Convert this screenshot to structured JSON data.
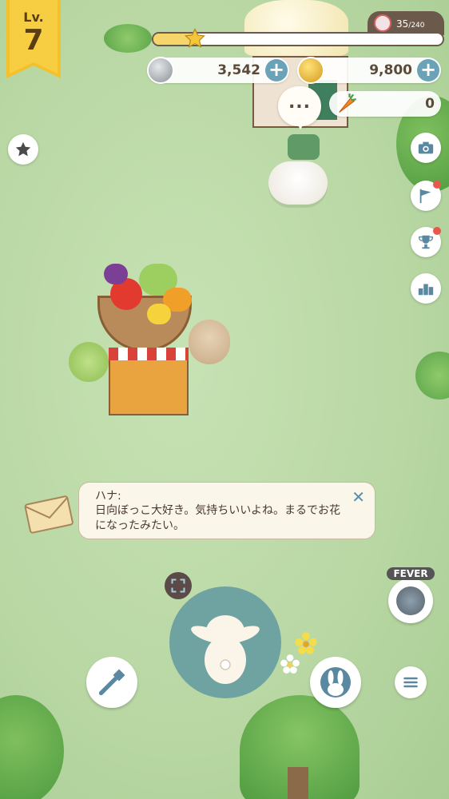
{
  "level": {
    "prefix": "Lv.",
    "value": "7"
  },
  "experience": {
    "current": 35,
    "max": 240,
    "current_label": "35",
    "max_label": "/240"
  },
  "currencies": {
    "silver_coins": "3,542",
    "gold_coins": "9,800",
    "carrots": "0",
    "plus_label": "+"
  },
  "speech_bubble": {
    "text": "..."
  },
  "side_buttons": {
    "camera_icon": "camera-icon",
    "flag_icon": "flag-icon",
    "trophy_icon": "trophy-icon",
    "ranking_icon": "ranking-icon",
    "star_icon": "star-icon"
  },
  "dialog": {
    "speaker": "ハナ:",
    "message": "日向ぼっこ大好き。気持ちいいよね。まるでお花になったみたい。",
    "close_label": "✕"
  },
  "fever": {
    "label": "FEVER"
  },
  "bottom_bar": {
    "expand_icon": "expand-icon",
    "hammer_icon": "hammer-icon",
    "rabbit_icon": "rabbit-icon",
    "menu_icon": "menu-icon"
  },
  "colors": {
    "grass": "#b9d8a4",
    "accent_teal": "#6fa3a2",
    "level_badge": "#f4c02b",
    "plus_blue": "#6aa3b8",
    "notification_red": "#e9574d"
  }
}
